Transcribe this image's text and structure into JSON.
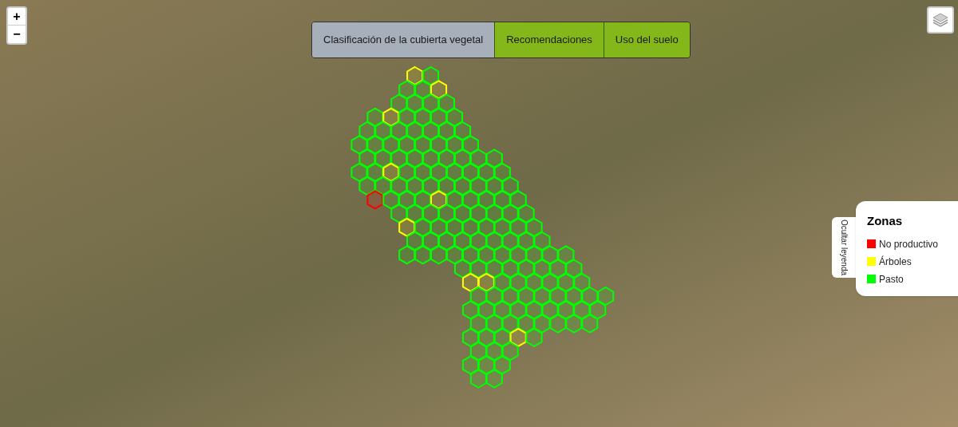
{
  "zoom_controls": [
    "+",
    "−"
  ],
  "tabs": [
    {
      "label": "Clasificación de la cubierta vegetal",
      "selected": true
    },
    {
      "label": "Recomendaciones",
      "selected": false
    },
    {
      "label": "Uso del suelo",
      "selected": false
    }
  ],
  "legend": {
    "toggle_label": "Ocultar leyenda",
    "title": "Zonas",
    "zones": [
      {
        "label": "No productivo",
        "color": "#ff0000"
      },
      {
        "label": "Árboles",
        "color": "#ffff00"
      },
      {
        "label": "Pasto",
        "color": "#00ff00"
      }
    ]
  }
}
